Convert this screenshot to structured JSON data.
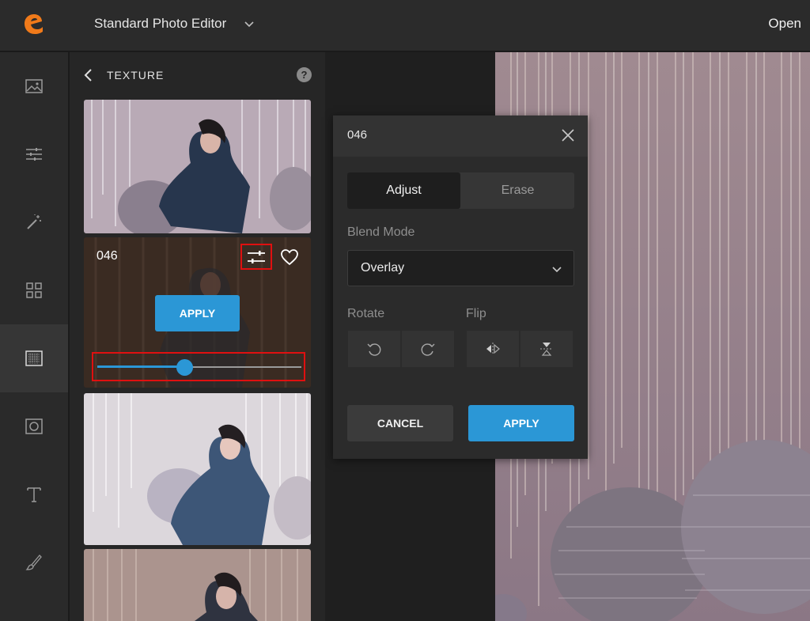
{
  "app": {
    "title": "Standard Photo Editor",
    "open_label": "Open",
    "accent": "#2b97d6",
    "logo_color": "#f07a1a"
  },
  "rail": {
    "items": [
      {
        "name": "image-icon",
        "active": false
      },
      {
        "name": "sliders-icon",
        "active": false
      },
      {
        "name": "magic-wand-icon",
        "active": false
      },
      {
        "name": "grid-icon",
        "active": false
      },
      {
        "name": "texture-icon",
        "active": true
      },
      {
        "name": "frame-icon",
        "active": false
      },
      {
        "name": "text-icon",
        "active": false
      },
      {
        "name": "brush-icon",
        "active": false
      }
    ]
  },
  "panel": {
    "title": "TEXTURE",
    "help": "?",
    "card": {
      "label": "046",
      "apply_label": "APPLY",
      "slider_fraction": 0.43
    }
  },
  "popover": {
    "title": "046",
    "tabs": [
      {
        "label": "Adjust",
        "active": true
      },
      {
        "label": "Erase",
        "active": false
      }
    ],
    "blend_mode_label": "Blend Mode",
    "blend_mode_value": "Overlay",
    "rotate_label": "Rotate",
    "flip_label": "Flip",
    "cancel_label": "CANCEL",
    "apply_label": "APPLY"
  }
}
